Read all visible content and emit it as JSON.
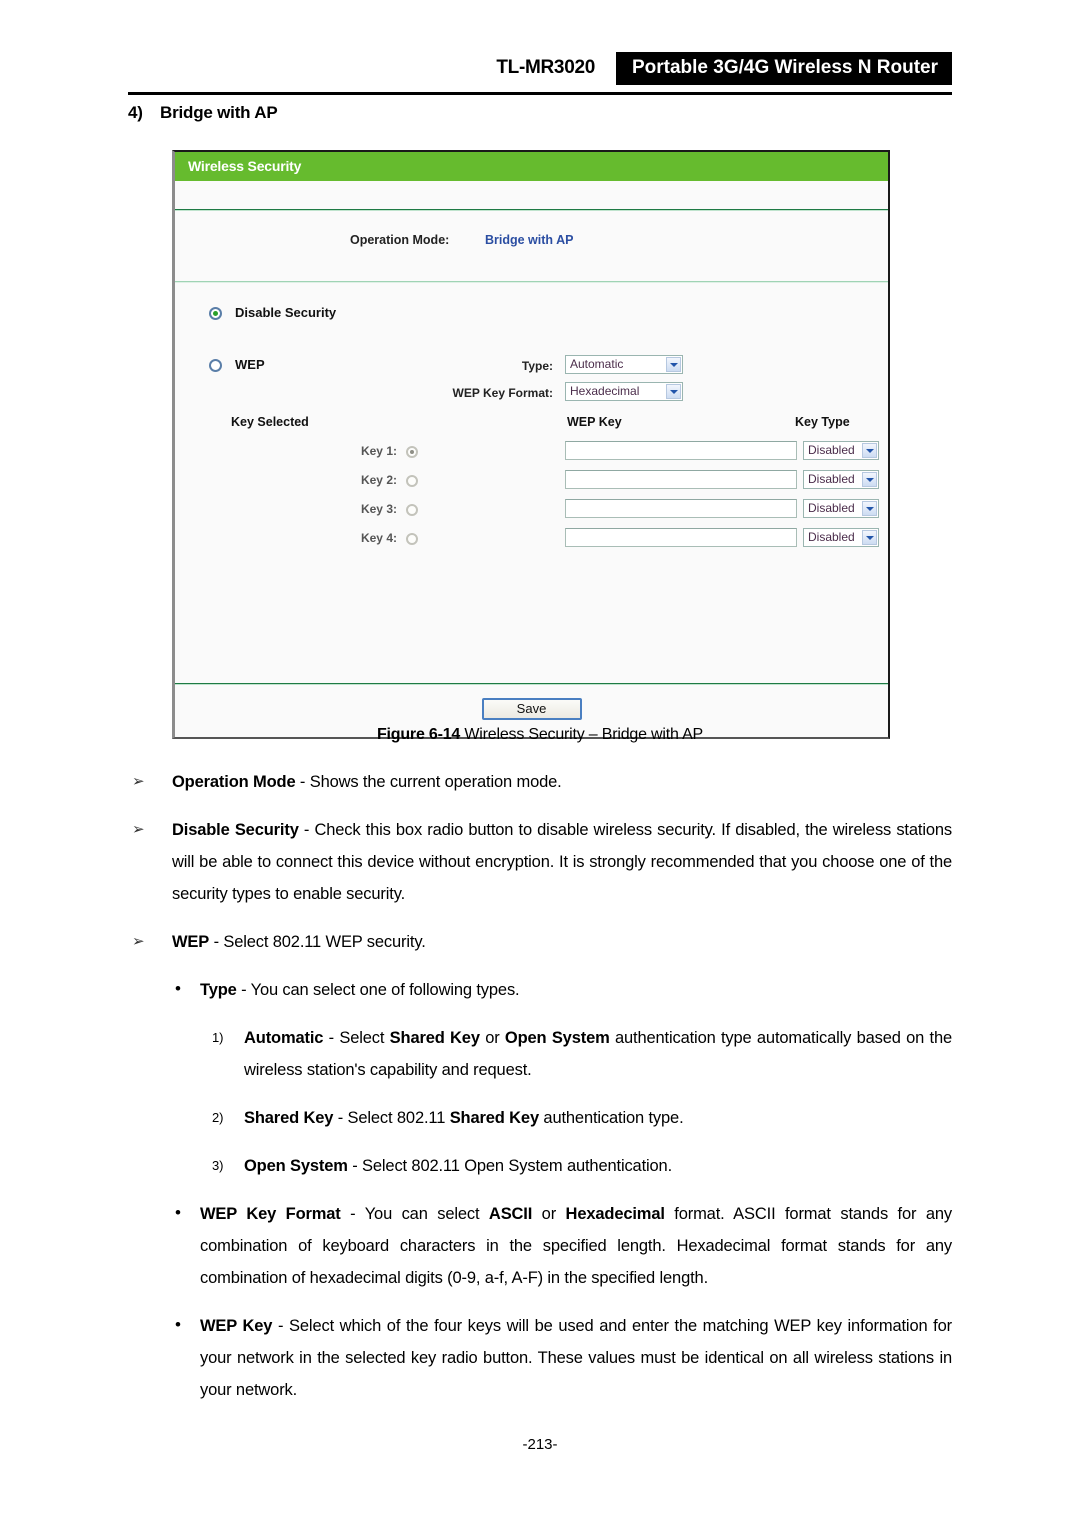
{
  "header": {
    "model": "TL-MR3020",
    "product": "Portable 3G/4G Wireless N Router"
  },
  "section": {
    "number": "4)",
    "title": "Bridge with AP"
  },
  "panel": {
    "title": "Wireless Security",
    "operation_mode": {
      "label": "Operation Mode:",
      "value": "Bridge with AP"
    },
    "options": {
      "disable_security": "Disable Security",
      "wep": "WEP"
    },
    "fields": {
      "type_label": "Type:",
      "type_value": "Automatic",
      "wep_key_format_label": "WEP Key Format:",
      "wep_key_format_value": "Hexadecimal"
    },
    "table_headers": {
      "key_selected": "Key Selected",
      "wep_key": "WEP Key",
      "key_type": "Key Type"
    },
    "keys": [
      {
        "label": "Key 1:",
        "value": "",
        "key_type": "Disabled",
        "selected": true
      },
      {
        "label": "Key 2:",
        "value": "",
        "key_type": "Disabled",
        "selected": false
      },
      {
        "label": "Key 3:",
        "value": "",
        "key_type": "Disabled",
        "selected": false
      },
      {
        "label": "Key 4:",
        "value": "",
        "key_type": "Disabled",
        "selected": false
      }
    ],
    "save_label": "Save",
    "accent_green": "#66bb2e",
    "link_blue": "#2b4ea2"
  },
  "figure_caption": {
    "prefix": "Figure 6-14",
    "text": " Wireless Security – Bridge with AP"
  },
  "prose": {
    "b1_term": "Operation Mode",
    "b1_text": " - Shows the current operation mode.",
    "b2_term": "Disable Security",
    "b2_text": " - Check this box radio button to disable wireless security. If disabled, the wireless stations will be able to connect this device without encryption. It is strongly recommended that you choose one of the security types to enable security.",
    "b3_term": "WEP",
    "b3_text": " - Select 802.11 WEP security.",
    "b4_term": "Type",
    "b4_text": " - You can select one of following types.",
    "n1_marker": "1)",
    "n1_term": "Automatic",
    "n1_part1": " - Select ",
    "n1_b1": "Shared Key",
    "n1_part2": " or ",
    "n1_b2": "Open System",
    "n1_part3": " authentication type automatically based on the wireless station's capability and request.",
    "n2_marker": "2)",
    "n2_term": "Shared Key",
    "n2_part1": " - Select 802.11 ",
    "n2_b1": "Shared Key",
    "n2_part2": " authentication type.",
    "n3_marker": "3)",
    "n3_term": "Open System",
    "n3_part1": " - Select 802.11 Open System authentication.",
    "b5_term": "WEP Key Format",
    "b5_part1": " - You can select ",
    "b5_b1": "ASCII",
    "b5_part2": " or ",
    "b5_b2": "Hexadecimal",
    "b5_part3": " format. ASCII format stands for any combination of keyboard characters in the specified length. Hexadecimal format stands for any combination of hexadecimal digits (0-9, a-f, A-F) in the specified length.",
    "b6_term": "WEP Key",
    "b6_text": " - Select which of the four keys will be used and enter the matching WEP key information for your network in the selected key radio button. These values must be identical on all wireless stations in your network.",
    "arrow_marker": "➢",
    "dot_marker": "•"
  },
  "footer": {
    "page_number": "-213-"
  }
}
